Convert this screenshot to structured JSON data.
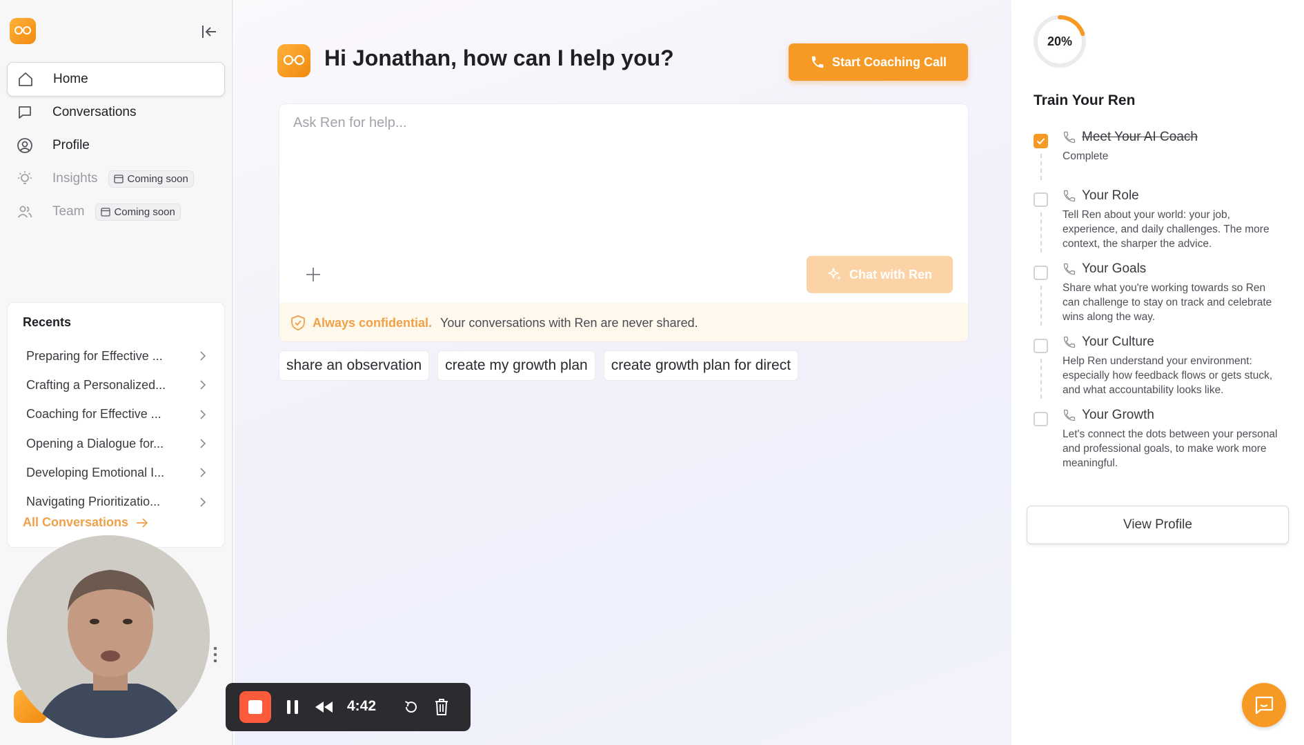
{
  "sidebar": {
    "nav": [
      {
        "label": "Home",
        "icon": "home-icon"
      },
      {
        "label": "Conversations",
        "icon": "chat-bubble-icon"
      },
      {
        "label": "Profile",
        "icon": "user-circle-icon"
      },
      {
        "label": "Insights",
        "icon": "lightbulb-icon",
        "badge": "Coming soon"
      },
      {
        "label": "Team",
        "icon": "team-icon",
        "badge": "Coming soon"
      }
    ],
    "recents": {
      "title": "Recents",
      "items": [
        "Preparing for Effective ...",
        "Crafting a Personalized...",
        "Coaching for Effective ...",
        "Opening a Dialogue for...",
        "Developing Emotional I...",
        "Navigating Prioritizatio..."
      ],
      "all_link": "All Conversations"
    }
  },
  "main": {
    "greeting": "Hi Jonathan, how can I help you?",
    "coach_button": "Start Coaching Call",
    "chat_placeholder": "Ask Ren for help...",
    "chat_button": "Chat with Ren",
    "confidential_strong": "Always confidential.",
    "confidential_text": "Your conversations with Ren are never shared.",
    "suggestions": [
      "share an observation",
      "create my growth plan",
      "create growth plan for direct"
    ]
  },
  "recording": {
    "time": "4:42"
  },
  "right_panel": {
    "progress_label": "20%",
    "progress_fraction": 0.2,
    "title": "Train Your Ren",
    "tasks": [
      {
        "title": "Meet Your AI Coach",
        "desc": "Complete",
        "done": true
      },
      {
        "title": "Your Role",
        "desc": "Tell Ren about your world: your job, experience, and daily challenges. The more context, the sharper the advice.",
        "done": false
      },
      {
        "title": "Your Goals",
        "desc": "Share what you're working towards so Ren can challenge to stay on track and celebrate wins along the way.",
        "done": false
      },
      {
        "title": "Your Culture",
        "desc": "Help Ren understand your environment: especially how feedback flows or gets stuck, and what accountability looks like.",
        "done": false
      },
      {
        "title": "Your Growth",
        "desc": "Let's connect the dots between your personal and professional goals, to make work more meaningful.",
        "done": false
      }
    ],
    "view_profile": "View Profile"
  },
  "colors": {
    "accent": "#f79a25",
    "accent_light": "#fcd3a6",
    "confidential_text": "#f0a048",
    "record_stop": "#fb5b3b"
  }
}
